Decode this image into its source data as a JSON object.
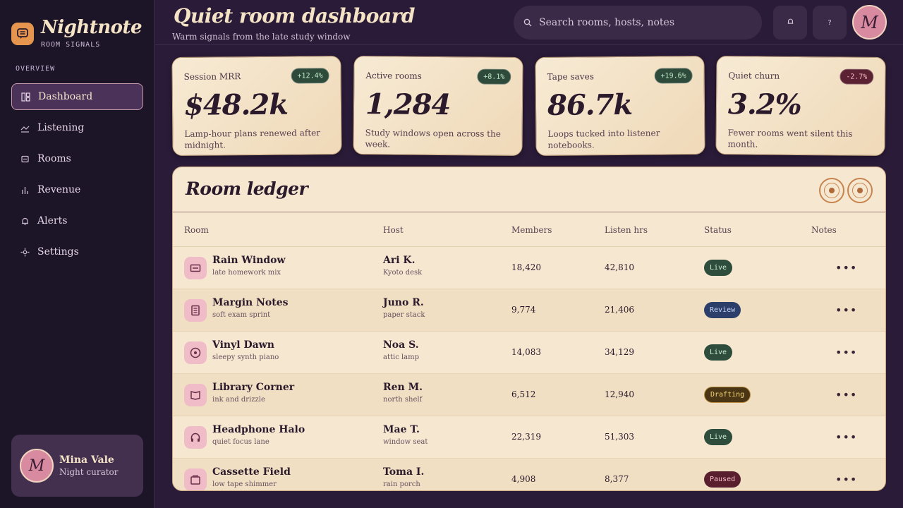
{
  "app": {
    "name": "Nightnote",
    "tagline": "ROOM SIGNALS"
  },
  "sidebar": {
    "section": "OVERVIEW",
    "items": [
      {
        "label": "Dashboard",
        "icon": "dashboard-icon",
        "active": true
      },
      {
        "label": "Listening",
        "icon": "chart-line-icon"
      },
      {
        "label": "Rooms",
        "icon": "room-icon"
      },
      {
        "label": "Revenue",
        "icon": "bar-chart-icon"
      },
      {
        "label": "Alerts",
        "icon": "bell-icon"
      },
      {
        "label": "Settings",
        "icon": "gear-icon"
      }
    ],
    "user": {
      "initial": "M",
      "name": "Mina Vale",
      "role": "Night curator"
    }
  },
  "header": {
    "title": "Quiet room dashboard",
    "subtitle": "Warm signals from the late study window",
    "search_placeholder": "Search rooms, hosts, notes",
    "avatar_initial": "M",
    "help_label": "?"
  },
  "kpis": [
    {
      "label": "Session MRR",
      "badge": "+12.4%",
      "trend": "up",
      "value": "$48.2k",
      "desc": "Lamp-hour plans renewed after midnight."
    },
    {
      "label": "Active rooms",
      "badge": "+8.1%",
      "trend": "up",
      "value": "1,284",
      "desc": "Study windows open across the week."
    },
    {
      "label": "Tape saves",
      "badge": "+19.6%",
      "trend": "up",
      "value": "86.7k",
      "desc": "Loops tucked into listener notebooks."
    },
    {
      "label": "Quiet churn",
      "badge": "-2.7%",
      "trend": "down",
      "value": "3.2%",
      "desc": "Fewer rooms went silent this month."
    }
  ],
  "ledger": {
    "title": "Room ledger",
    "columns": [
      "Room",
      "Host",
      "Members",
      "Listen hrs",
      "Status",
      "Notes"
    ],
    "rows": [
      {
        "room": "Rain Window",
        "room_sub": "late homework mix",
        "icon": "window-icon",
        "host": "Ari K.",
        "host_sub": "Kyoto desk",
        "members": "18,420",
        "hours": "42,810",
        "status": "Live"
      },
      {
        "room": "Margin Notes",
        "room_sub": "soft exam sprint",
        "icon": "notes-icon",
        "host": "Juno R.",
        "host_sub": "paper stack",
        "members": "9,774",
        "hours": "21,406",
        "status": "Review"
      },
      {
        "room": "Vinyl Dawn",
        "room_sub": "sleepy synth piano",
        "icon": "vinyl-icon",
        "host": "Noa S.",
        "host_sub": "attic lamp",
        "members": "14,083",
        "hours": "34,129",
        "status": "Live"
      },
      {
        "room": "Library Corner",
        "room_sub": "ink and drizzle",
        "icon": "book-icon",
        "host": "Ren M.",
        "host_sub": "north shelf",
        "members": "6,512",
        "hours": "12,940",
        "status": "Drafting"
      },
      {
        "room": "Headphone Halo",
        "room_sub": "quiet focus lane",
        "icon": "headphones-icon",
        "host": "Mae T.",
        "host_sub": "window seat",
        "members": "22,319",
        "hours": "51,303",
        "status": "Live"
      },
      {
        "room": "Cassette Field",
        "room_sub": "low tape shimmer",
        "icon": "cassette-icon",
        "host": "Toma I.",
        "host_sub": "rain porch",
        "members": "4,908",
        "hours": "8,377",
        "status": "Paused"
      }
    ],
    "more_label": "•••"
  },
  "colors": {
    "background": "#2a1b38",
    "sidebar": "#1c1427",
    "card": "#f5e7d0",
    "accent": "#e6954f",
    "avatar": "#d88aa0"
  }
}
